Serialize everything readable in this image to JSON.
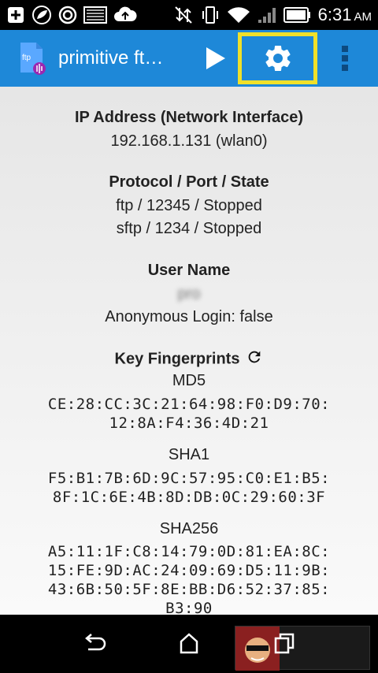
{
  "status_bar": {
    "time": "6:31",
    "ampm": "AM"
  },
  "app_bar": {
    "title": "primitive ft…",
    "icon_label": "ftp"
  },
  "ip": {
    "heading": "IP Address (Network Interface)",
    "value": "192.168.1.131 (wlan0)"
  },
  "protocol": {
    "heading": "Protocol / Port / State",
    "rows": [
      "ftp / 12345 / Stopped",
      "sftp / 1234 / Stopped"
    ]
  },
  "user": {
    "heading": "User Name",
    "name": "pro",
    "anonymous": "Anonymous Login: false"
  },
  "fingerprints": {
    "heading": "Key Fingerprints",
    "md5_label": "MD5",
    "md5": [
      "CE:28:CC:3C:21:64:98:F0:D9:70:",
      "12:8A:F4:36:4D:21"
    ],
    "sha1_label": "SHA1",
    "sha1": [
      "F5:B1:7B:6D:9C:57:95:C0:E1:B5:",
      "8F:1C:6E:4B:8D:DB:0C:29:60:3F"
    ],
    "sha256_label": "SHA256",
    "sha256": [
      "A5:11:1F:C8:14:79:0D:81:EA:8C:",
      "15:FE:9D:AC:24:09:69:D5:11:9B:",
      "43:6B:50:5F:8E:BB:D6:52:37:85:",
      "B3:90"
    ]
  },
  "colors": {
    "app_bar": "#1e88d8",
    "highlight": "#f0e02a"
  }
}
